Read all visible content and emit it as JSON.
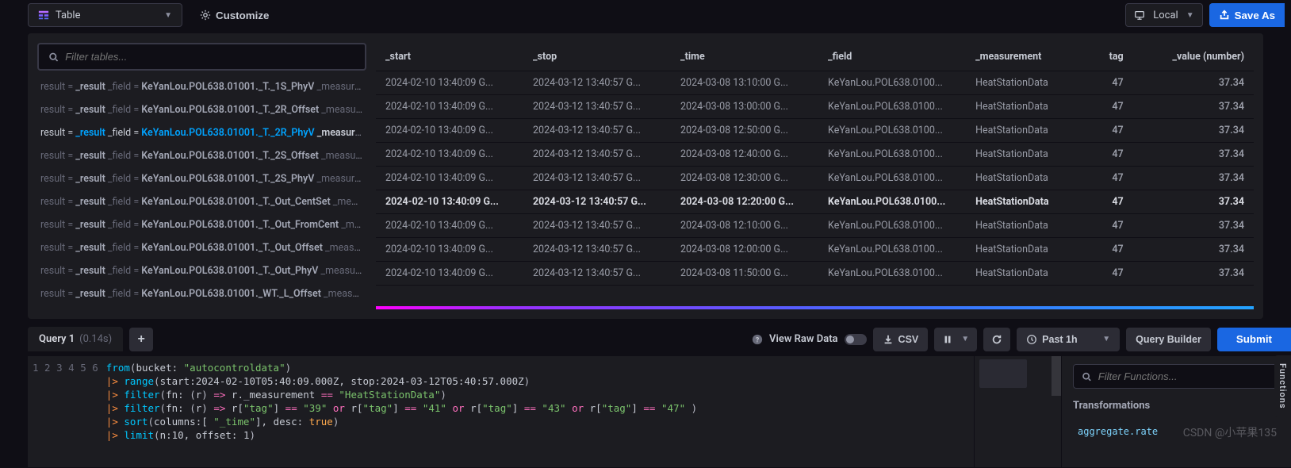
{
  "toolbar": {
    "view_type": "Table",
    "customize": "Customize",
    "local": "Local",
    "save_as": "Save As"
  },
  "left_panel": {
    "filter_placeholder": "Filter tables...",
    "result_label_pre": "result = ",
    "result_val": "_result",
    "field_label_pre": "   _field = ",
    "meas_label_pre": "   _measuremen",
    "items": [
      {
        "field": "KeYanLou.POL638.01001._T._1S_PhyV",
        "selected": false
      },
      {
        "field": "KeYanLou.POL638.01001._T._2R_Offset",
        "selected": false
      },
      {
        "field": "KeYanLou.POL638.01001._T._2R_PhyV",
        "selected": true
      },
      {
        "field": "KeYanLou.POL638.01001._T._2S_Offset",
        "selected": false
      },
      {
        "field": "KeYanLou.POL638.01001._T._2S_PhyV",
        "selected": false
      },
      {
        "field": "KeYanLou.POL638.01001._T._Out_CentSet",
        "selected": false
      },
      {
        "field": "KeYanLou.POL638.01001._T._Out_FromCent",
        "selected": false
      },
      {
        "field": "KeYanLou.POL638.01001._T._Out_Offset",
        "selected": false
      },
      {
        "field": "KeYanLou.POL638.01001._T._Out_PhyV",
        "selected": false
      },
      {
        "field": "KeYanLou.POL638.01001._WT._L_Offset",
        "selected": false
      }
    ]
  },
  "table": {
    "columns": [
      "_start",
      "_stop",
      "_time",
      "_field",
      "_measurement",
      "tag",
      "_value (number)"
    ],
    "rows": [
      {
        "start": "2024-02-10 13:40:09 G...",
        "stop": "2024-03-12 13:40:57 G...",
        "time": "2024-03-08 13:10:00 G...",
        "field": "KeYanLou.POL638.0100...",
        "meas": "HeatStationData",
        "tag": "47",
        "val": "37.34",
        "hl": false
      },
      {
        "start": "2024-02-10 13:40:09 G...",
        "stop": "2024-03-12 13:40:57 G...",
        "time": "2024-03-08 13:00:00 G...",
        "field": "KeYanLou.POL638.0100...",
        "meas": "HeatStationData",
        "tag": "47",
        "val": "37.34",
        "hl": false
      },
      {
        "start": "2024-02-10 13:40:09 G...",
        "stop": "2024-03-12 13:40:57 G...",
        "time": "2024-03-08 12:50:00 G...",
        "field": "KeYanLou.POL638.0100...",
        "meas": "HeatStationData",
        "tag": "47",
        "val": "37.34",
        "hl": false
      },
      {
        "start": "2024-02-10 13:40:09 G...",
        "stop": "2024-03-12 13:40:57 G...",
        "time": "2024-03-08 12:40:00 G...",
        "field": "KeYanLou.POL638.0100...",
        "meas": "HeatStationData",
        "tag": "47",
        "val": "37.34",
        "hl": false
      },
      {
        "start": "2024-02-10 13:40:09 G...",
        "stop": "2024-03-12 13:40:57 G...",
        "time": "2024-03-08 12:30:00 G...",
        "field": "KeYanLou.POL638.0100...",
        "meas": "HeatStationData",
        "tag": "47",
        "val": "37.34",
        "hl": false
      },
      {
        "start": "2024-02-10 13:40:09 G...",
        "stop": "2024-03-12 13:40:57 G...",
        "time": "2024-03-08 12:20:00 G...",
        "field": "KeYanLou.POL638.0100...",
        "meas": "HeatStationData",
        "tag": "47",
        "val": "37.34",
        "hl": true
      },
      {
        "start": "2024-02-10 13:40:09 G...",
        "stop": "2024-03-12 13:40:57 G...",
        "time": "2024-03-08 12:10:00 G...",
        "field": "KeYanLou.POL638.0100...",
        "meas": "HeatStationData",
        "tag": "47",
        "val": "37.34",
        "hl": false
      },
      {
        "start": "2024-02-10 13:40:09 G...",
        "stop": "2024-03-12 13:40:57 G...",
        "time": "2024-03-08 12:00:00 G...",
        "field": "KeYanLou.POL638.0100...",
        "meas": "HeatStationData",
        "tag": "47",
        "val": "37.34",
        "hl": false
      },
      {
        "start": "2024-02-10 13:40:09 G...",
        "stop": "2024-03-12 13:40:57 G...",
        "time": "2024-03-08 11:50:00 G...",
        "field": "KeYanLou.POL638.0100...",
        "meas": "HeatStationData",
        "tag": "47",
        "val": "37.34",
        "hl": false
      }
    ]
  },
  "query_bar": {
    "tab_name": "Query 1",
    "tab_time": "(0.14s)",
    "view_raw": "View Raw Data",
    "csv": "CSV",
    "past": "Past 1h",
    "query_builder": "Query Builder",
    "submit": "Submit"
  },
  "editor": {
    "lines": [
      "1",
      "2",
      "3",
      "4",
      "5",
      "6"
    ],
    "code": {
      "l1_bucket": "\"autocontroldata\"",
      "l2_start": "2024-02-10T05:40:09.000Z",
      "l2_stop": "2024-03-12T05:40:57.000Z",
      "l3_meas": "\"HeatStationData\"",
      "l4_tags": [
        "\"39\"",
        "\"41\"",
        "\"43\"",
        "\"47\""
      ]
    }
  },
  "func_panel": {
    "filter_placeholder": "Filter Functions...",
    "section": "Transformations",
    "item1": "aggregate.rate"
  },
  "side_tab": "Functions",
  "watermark": "CSDN @小苹果135"
}
